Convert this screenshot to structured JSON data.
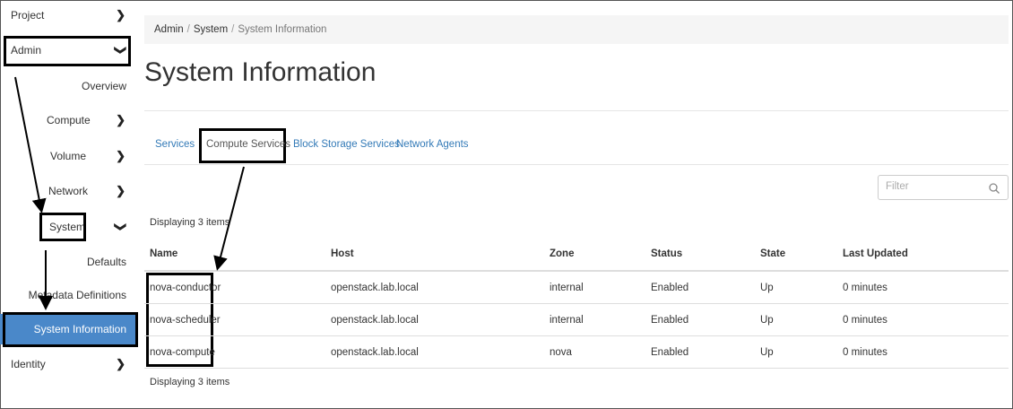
{
  "sidebar": {
    "project": "Project",
    "admin": "Admin",
    "overview": "Overview",
    "compute": "Compute",
    "volume": "Volume",
    "network": "Network",
    "system": "System",
    "defaults": "Defaults",
    "metadata": "Metadata Definitions",
    "system_information": "System Information",
    "identity": "Identity"
  },
  "breadcrumb": {
    "item1": "Admin",
    "item2": "System",
    "item3": "System Information"
  },
  "page": {
    "title": "System Information"
  },
  "tabs": {
    "services": "Services",
    "compute_services": "Compute Services",
    "block_storage": "Block Storage Services",
    "network_agents": "Network Agents"
  },
  "filter": {
    "placeholder": "Filter"
  },
  "table": {
    "count_top": "Displaying 3 items",
    "count_bottom": "Displaying 3 items",
    "headers": [
      "Name",
      "Host",
      "Zone",
      "Status",
      "State",
      "Last Updated"
    ],
    "rows": [
      [
        "nova-conductor",
        "openstack.lab.local",
        "internal",
        "Enabled",
        "Up",
        "0 minutes"
      ],
      [
        "nova-scheduler",
        "openstack.lab.local",
        "internal",
        "Enabled",
        "Up",
        "0 minutes"
      ],
      [
        "nova-compute",
        "openstack.lab.local",
        "nova",
        "Enabled",
        "Up",
        "0 minutes"
      ]
    ]
  },
  "colors": {
    "active_nav": "#4a88c9",
    "link": "#337ab7",
    "annotation": "#000000"
  }
}
